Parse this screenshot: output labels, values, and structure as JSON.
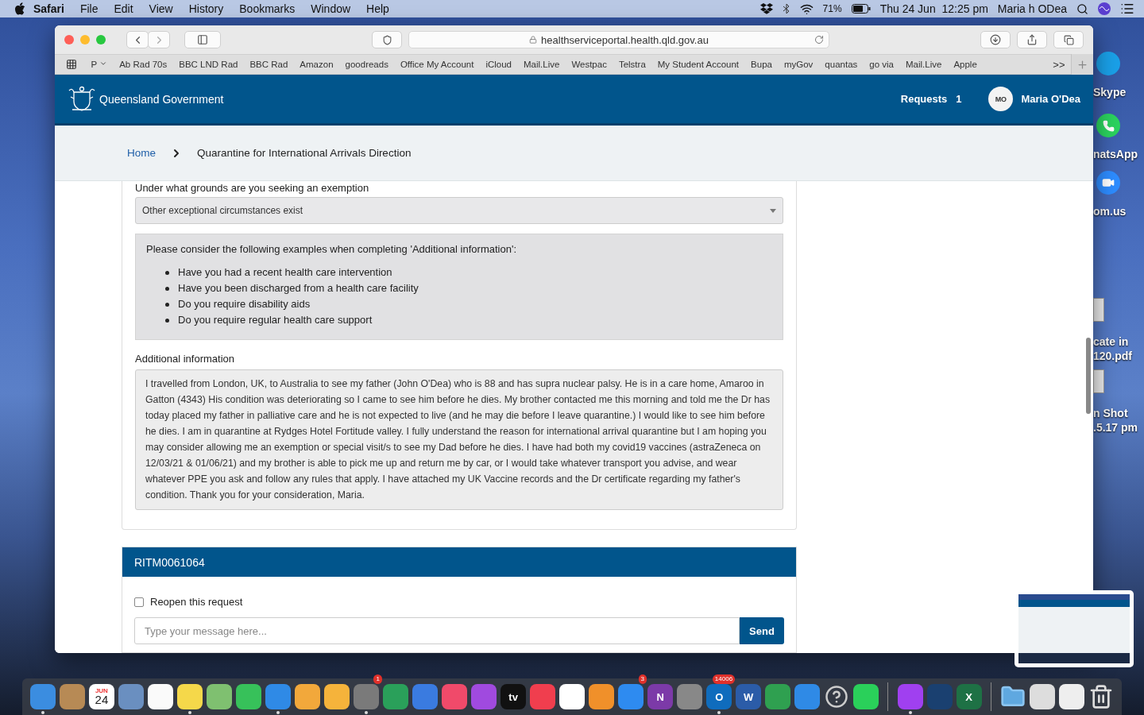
{
  "menu_bar": {
    "app": "Safari",
    "items": [
      "File",
      "Edit",
      "View",
      "History",
      "Bookmarks",
      "Window",
      "Help"
    ],
    "battery": "71%",
    "clock": "Thu 24 Jun  12:25 pm",
    "user": "Maria h ODea"
  },
  "browser": {
    "address": "healthserviceportal.health.qld.gov.au",
    "bookmarks_menu": "P",
    "bookmarks": [
      "Ab Rad 70s",
      "BBC LND Rad",
      "BBC Rad",
      "Amazon",
      "goodreads",
      "Office My Account",
      "iCloud",
      "Mail.Live",
      "Westpac",
      "Telstra",
      "My Student Account",
      "Bupa",
      "myGov",
      "quantas",
      "go via",
      "Mail.Live",
      "Apple"
    ],
    "overflow": ">>"
  },
  "site_header": {
    "brand": "Queensland Government",
    "requests_label": "Requests",
    "requests_count": "1",
    "avatar_initials": "MO",
    "user_name": "Maria O'Dea"
  },
  "breadcrumb": [
    {
      "label": "Home",
      "link": true
    },
    {
      "label": "Quarantine for International Arrivals Direction",
      "link": false
    }
  ],
  "form": {
    "grounds_label": "Under what grounds are you seeking an exemption",
    "grounds_value": "Other exceptional circumstances exist",
    "guidance_intro": "Please consider the following examples when completing 'Additional information':",
    "guidance_items": [
      "Have you had a recent health care intervention",
      "Have you been discharged from a health care facility",
      "Do you require disability aids",
      "Do you require regular health care support"
    ],
    "additional_label": "Additional information",
    "additional_value": "I travelled from London, UK, to Australia to see my father (John O'Dea) who is 88 and has supra nuclear palsy. He is in a care home, Amaroo in Gatton (4343) His condition was deteriorating so I came to see him before he dies. My brother contacted me this morning and told me the Dr has today placed my father in palliative care and he  is not expected to live (and he may die before I leave quarantine.) I would like to see him before he dies. I am in quarantine at Rydges Hotel Fortitude valley. I fully understand the reason for international arrival quarantine but I am hoping you may consider allowing me an exemption or  special visit/s to see my Dad before he dies.  I have had both my covid19 vaccines (astraZeneca on 12/03/21 & 01/06/21) and my brother is able to pick me up and return me by car, or I would take whatever transport you advise, and wear whatever PPE you ask and follow any rules that apply. I have attached my UK Vaccine records and the Dr certificate regarding my father's condition. Thank you for your consideration, Maria."
  },
  "request": {
    "number": "RITM0061064",
    "reopen_label": "Reopen this request",
    "reopen_checked": false,
    "message_placeholder": "Type your message here...",
    "send_label": "Send"
  },
  "desktop_icons": [
    {
      "kind": "skype",
      "lines": [
        "Skype"
      ]
    },
    {
      "kind": "whatsapp",
      "lines": [
        "natsApp"
      ]
    },
    {
      "kind": "zoom",
      "lines": [
        "om.us"
      ]
    },
    {
      "kind": "pdf",
      "lines": [
        "cate in",
        "120.pdf"
      ]
    },
    {
      "kind": "screenshot",
      "lines": [
        "n Shot",
        ".5.17 pm"
      ]
    }
  ],
  "dock": [
    {
      "kind": "app",
      "running": true
    },
    {
      "kind": "app",
      "running": false
    },
    {
      "kind": "calendar",
      "running": false,
      "month": "JUN",
      "day": "24"
    },
    {
      "kind": "app",
      "running": false
    },
    {
      "kind": "app",
      "running": false
    },
    {
      "kind": "app",
      "running": true
    },
    {
      "kind": "app",
      "running": false
    },
    {
      "kind": "app",
      "running": false
    },
    {
      "kind": "app",
      "running": true
    },
    {
      "kind": "app",
      "running": false
    },
    {
      "kind": "app",
      "running": false
    },
    {
      "kind": "app",
      "running": true,
      "badge": "1"
    },
    {
      "kind": "app",
      "running": false
    },
    {
      "kind": "app",
      "running": false
    },
    {
      "kind": "app",
      "running": false
    },
    {
      "kind": "app",
      "running": false
    },
    {
      "kind": "tv",
      "running": false,
      "label": "tv"
    },
    {
      "kind": "app",
      "running": false
    },
    {
      "kind": "app",
      "running": false
    },
    {
      "kind": "app",
      "running": false
    },
    {
      "kind": "app",
      "running": false,
      "badge": "3"
    },
    {
      "kind": "app",
      "running": false,
      "label": "N"
    },
    {
      "kind": "app",
      "running": false
    },
    {
      "kind": "app",
      "running": true,
      "badge": "14006",
      "label": "O"
    },
    {
      "kind": "app",
      "running": false,
      "label": "W"
    },
    {
      "kind": "app",
      "running": false
    },
    {
      "kind": "app",
      "running": false
    },
    {
      "kind": "unknown",
      "running": false
    },
    {
      "kind": "app",
      "running": false
    },
    {
      "kind": "divider"
    },
    {
      "kind": "app",
      "running": true
    },
    {
      "kind": "app",
      "running": false
    },
    {
      "kind": "app",
      "running": false,
      "label": "X"
    },
    {
      "kind": "divider"
    },
    {
      "kind": "folder",
      "running": false
    },
    {
      "kind": "app",
      "running": false
    },
    {
      "kind": "app",
      "running": false
    },
    {
      "kind": "trash",
      "running": false
    }
  ]
}
